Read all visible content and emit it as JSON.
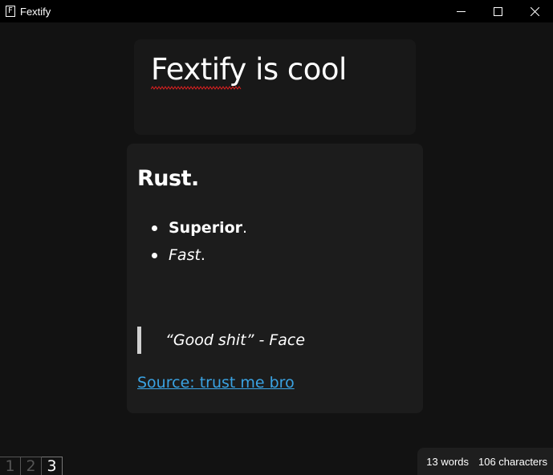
{
  "window": {
    "icon_glyph": "F",
    "title": "Fextify",
    "controls": [
      "minimize-icon",
      "maximize-icon",
      "close-icon"
    ]
  },
  "editor": {
    "title": "Fextify is cool"
  },
  "preview": {
    "heading": "Rust.",
    "list": [
      {
        "strong": "Superior",
        "suffix": "."
      },
      {
        "em": "Fast",
        "suffix": "."
      }
    ],
    "quote": "“Good shit” - Face",
    "link_text": "Source: trust me bro",
    "link_color": "#3aa3e3"
  },
  "pages": {
    "items": [
      "1",
      "2",
      "3"
    ],
    "active": "3"
  },
  "status": {
    "words": "13 words",
    "characters": "106 characters"
  },
  "colors": {
    "background": "#121212",
    "titlebar": "#000000",
    "card_title": "#181818",
    "card_preview": "#1c1c1c",
    "spellcheck": "#e02020"
  }
}
